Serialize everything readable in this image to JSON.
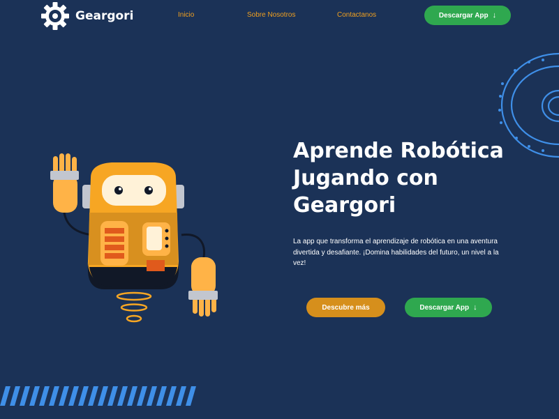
{
  "brand": {
    "name": "Geargori",
    "accent_orange": "#f0a020",
    "accent_green": "#2fa84f",
    "background": "#1b3257",
    "logo_icon": "gear-icon"
  },
  "nav": {
    "items": [
      {
        "label": "Inicio"
      },
      {
        "label": "Sobre Nosotros"
      },
      {
        "label": "Contactanos"
      }
    ],
    "download_label": "Descargar App",
    "download_icon": "arrow-down-icon"
  },
  "hero": {
    "title_lines": [
      "Aprende Robótica",
      "Jugando con",
      "Geargori"
    ],
    "description": "La app que transforma el aprendizaje de robótica en una aventura divertida y desafiante. ¡Domina habilidades del futuro, un nivel a la vez!",
    "primary_button": "Descubre más",
    "secondary_button": "Descargar App",
    "illustration_icon": "robot-mascot-icon"
  }
}
